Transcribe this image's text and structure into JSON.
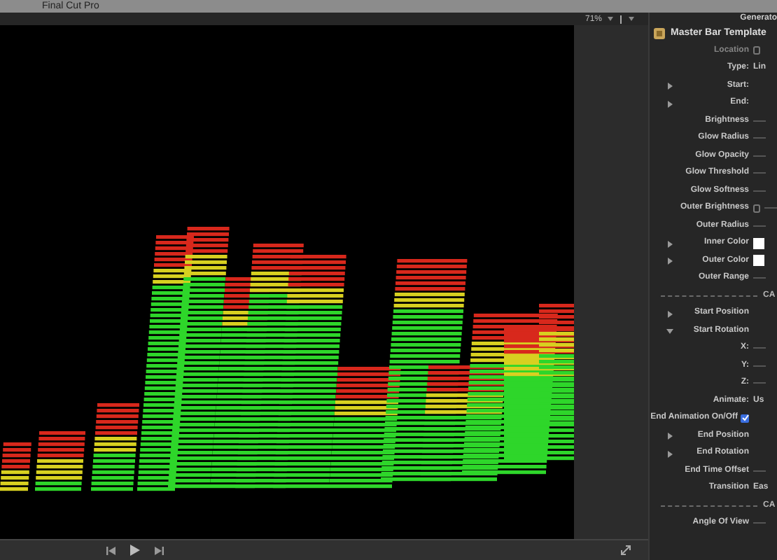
{
  "menu_bar": {
    "app_name": "Final Cut Pro"
  },
  "viewer": {
    "zoom": "71%"
  },
  "inspector": {
    "title": "Generato",
    "generator_name": "Master Bar Template",
    "rows": [
      {
        "kind": "param",
        "label": "Location",
        "disabled": true,
        "keyframe": true
      },
      {
        "kind": "param",
        "label": "Type:",
        "value": "Lin"
      },
      {
        "kind": "group",
        "label": "Start:",
        "expanded": false
      },
      {
        "kind": "group",
        "label": "End:",
        "expanded": false
      },
      {
        "kind": "slider",
        "label": "Brightness"
      },
      {
        "kind": "slider",
        "label": "Glow Radius"
      },
      {
        "kind": "slider",
        "label": "Glow Opacity"
      },
      {
        "kind": "slider",
        "label": "Glow Threshold"
      },
      {
        "kind": "slider",
        "label": "Glow Softness"
      },
      {
        "kind": "slider",
        "label": "Outer Brightness",
        "keyframe": true
      },
      {
        "kind": "slider",
        "label": "Outer Radius"
      },
      {
        "kind": "color",
        "label": "Inner Color",
        "expanded": false,
        "color": "#ffffff"
      },
      {
        "kind": "color",
        "label": "Outer Color",
        "expanded": false,
        "color": "#ffffff"
      },
      {
        "kind": "slider",
        "label": "Outer Range"
      },
      {
        "kind": "section",
        "label": "CA"
      },
      {
        "kind": "group",
        "label": "Start Position",
        "expanded": false
      },
      {
        "kind": "group",
        "label": "Start Rotation",
        "expanded": true
      },
      {
        "kind": "slider",
        "label": "X:"
      },
      {
        "kind": "slider",
        "label": "Y:"
      },
      {
        "kind": "slider",
        "label": "Z:"
      },
      {
        "kind": "param",
        "label": "Animate:",
        "value": "Us"
      },
      {
        "kind": "checkbox",
        "label": "End Animation On/Off",
        "checked": true
      },
      {
        "kind": "group",
        "label": "End Position",
        "expanded": false
      },
      {
        "kind": "group",
        "label": "End Rotation",
        "expanded": false
      },
      {
        "kind": "slider",
        "label": "End Time Offset"
      },
      {
        "kind": "param",
        "label": "Transition",
        "value": "Eas"
      },
      {
        "kind": "section",
        "label": "CA"
      },
      {
        "kind": "slider",
        "label": "Angle Of View"
      }
    ]
  }
}
